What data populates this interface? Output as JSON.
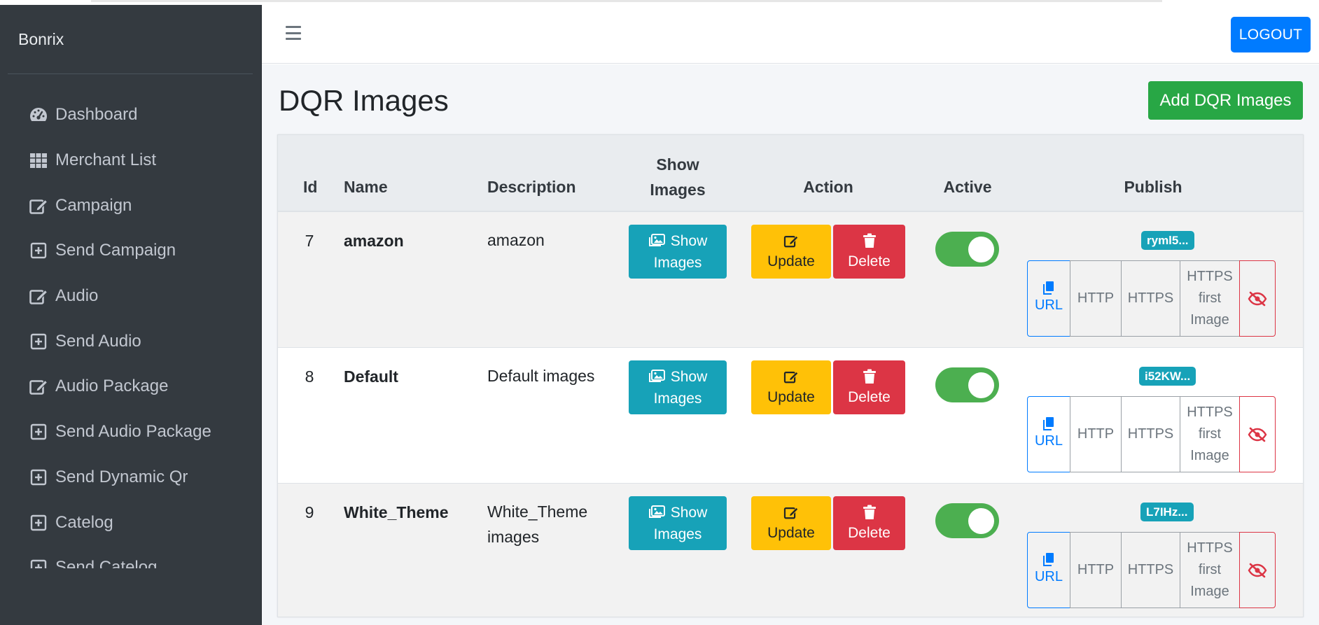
{
  "brand": "Bonrix",
  "header": {
    "logout_label": "LOGOUT"
  },
  "sidebar": {
    "items": [
      {
        "label": "Dashboard",
        "icon": "dashboard-icon"
      },
      {
        "label": "Merchant List",
        "icon": "grid-icon"
      },
      {
        "label": "Campaign",
        "icon": "edit-icon"
      },
      {
        "label": "Send Campaign",
        "icon": "plus-square-icon"
      },
      {
        "label": "Audio",
        "icon": "edit-icon"
      },
      {
        "label": "Send Audio",
        "icon": "plus-square-icon"
      },
      {
        "label": "Audio Package",
        "icon": "edit-icon"
      },
      {
        "label": "Send Audio Package",
        "icon": "plus-square-icon"
      },
      {
        "label": "Send Dynamic Qr",
        "icon": "plus-square-icon"
      },
      {
        "label": "Catelog",
        "icon": "plus-square-icon"
      },
      {
        "label": "Send Catelog",
        "icon": "plus-square-icon"
      }
    ]
  },
  "page": {
    "title": "DQR Images",
    "add_button": "Add DQR Images"
  },
  "table": {
    "headers": {
      "id": "Id",
      "name": "Name",
      "description": "Description",
      "show_images_1": "Show",
      "show_images_2": "Images",
      "action": "Action",
      "active": "Active",
      "publish": "Publish"
    },
    "buttons": {
      "show_1": "Show",
      "show_2": "Images",
      "update": "Update",
      "delete": "Delete",
      "url": "URL",
      "http": "HTTP",
      "https": "HTTPS",
      "first_1": "HTTPS",
      "first_2": "first",
      "first_3": "Image"
    },
    "rows": [
      {
        "id": "7",
        "name": "amazon",
        "description": "amazon",
        "active": true,
        "publish_badge": "ryml5..."
      },
      {
        "id": "8",
        "name": "Default",
        "description": "Default images",
        "active": true,
        "publish_badge": "i52KW..."
      },
      {
        "id": "9",
        "name": "White_Theme",
        "description": "White_Theme images",
        "active": true,
        "publish_badge": "L7IHz..."
      }
    ]
  },
  "colors": {
    "sidebar_bg": "#343a40",
    "primary": "#007bff",
    "success": "#28a745",
    "info": "#17a2b8",
    "warning": "#ffc107",
    "danger": "#dc3545",
    "toggle_on": "#4caf50"
  }
}
